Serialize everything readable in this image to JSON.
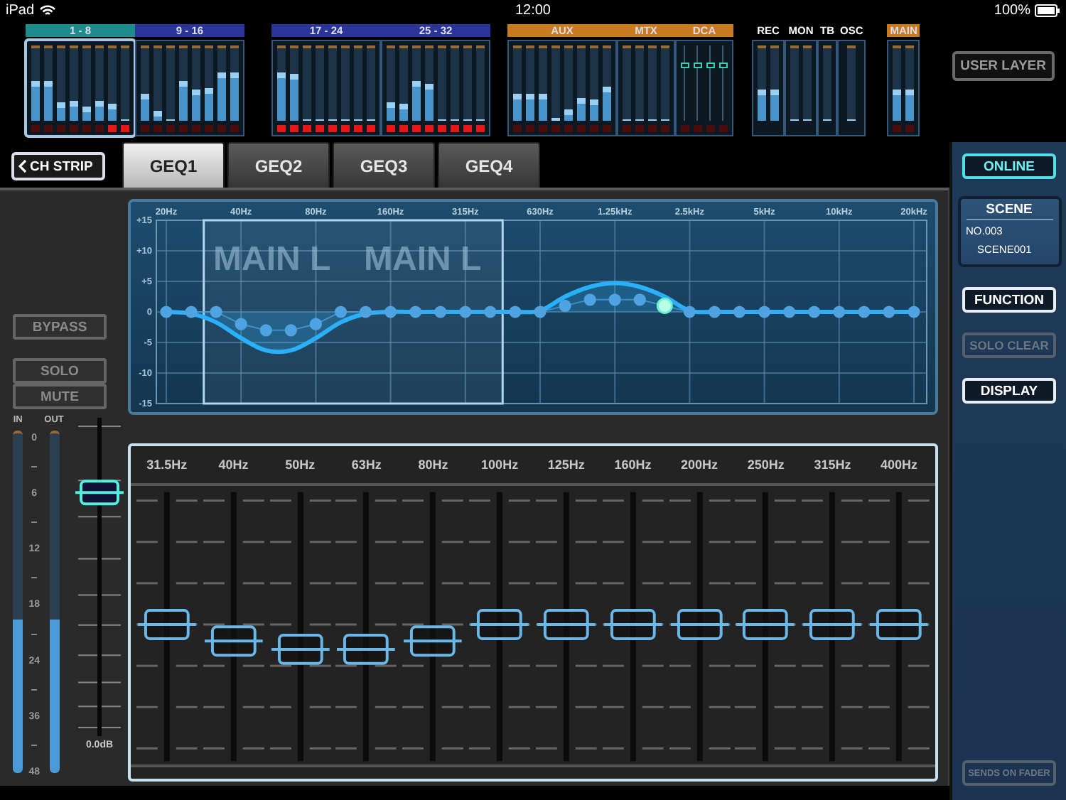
{
  "status_bar": {
    "device": "iPad",
    "time": "12:00",
    "battery": "100%"
  },
  "meter_bridge": {
    "blocks": [
      {
        "banks": [
          {
            "label": "1 - 8",
            "color": "#1e8c8c",
            "selected": true,
            "kind": "meters",
            "meters": [
              {
                "level": 0.55,
                "clip": false
              },
              {
                "level": 0.55,
                "clip": false
              },
              {
                "level": 0.26,
                "clip": false
              },
              {
                "level": 0.27,
                "clip": false
              },
              {
                "level": 0.2,
                "clip": false
              },
              {
                "level": 0.27,
                "clip": false
              },
              {
                "level": 0.24,
                "clip": true
              },
              {
                "level": 0,
                "clip": true
              }
            ]
          },
          {
            "label": "9 - 16",
            "color": "#2b3499",
            "selected": false,
            "kind": "meters",
            "meters": [
              {
                "level": 0.37,
                "clip": false
              },
              {
                "level": 0.14,
                "clip": false
              },
              {
                "level": 0.02,
                "clip": false
              },
              {
                "level": 0.55,
                "clip": false
              },
              {
                "level": 0.43,
                "clip": false
              },
              {
                "level": 0.45,
                "clip": false
              },
              {
                "level": 0.67,
                "clip": false
              },
              {
                "level": 0.67,
                "clip": false
              }
            ]
          }
        ]
      },
      {
        "banks": [
          {
            "label": "17 - 24",
            "color": "#2b3499",
            "selected": false,
            "kind": "meters",
            "meters": [
              {
                "level": 0.67,
                "clip": true
              },
              {
                "level": 0.64,
                "clip": true
              },
              {
                "level": 0,
                "clip": true
              },
              {
                "level": 0,
                "clip": true
              },
              {
                "level": 0,
                "clip": true
              },
              {
                "level": 0,
                "clip": true
              },
              {
                "level": 0,
                "clip": true
              },
              {
                "level": 0,
                "clip": true
              }
            ]
          },
          {
            "label": "25 - 32",
            "color": "#2b3499",
            "selected": false,
            "kind": "meters",
            "meters": [
              {
                "level": 0.26,
                "clip": true
              },
              {
                "level": 0.23,
                "clip": true
              },
              {
                "level": 0.55,
                "clip": true
              },
              {
                "level": 0.51,
                "clip": true
              },
              {
                "level": 0,
                "clip": true
              },
              {
                "level": 0,
                "clip": true
              },
              {
                "level": 0,
                "clip": true
              },
              {
                "level": 0,
                "clip": true
              }
            ]
          }
        ]
      },
      {
        "banks": [
          {
            "label": "AUX",
            "color": "#c97a1e",
            "selected": false,
            "kind": "meters",
            "meters": [
              {
                "level": 0.37,
                "clip": false
              },
              {
                "level": 0.37,
                "clip": false
              },
              {
                "level": 0.37,
                "clip": false
              },
              {
                "level": 0.04,
                "clip": false
              },
              {
                "level": 0.17,
                "clip": false
              },
              {
                "level": 0.31,
                "clip": false
              },
              {
                "level": 0.3,
                "clip": false
              },
              {
                "level": 0.48,
                "clip": false
              }
            ]
          },
          {
            "label": "MTX",
            "color": "#c97a1e",
            "selected": false,
            "kind": "meters",
            "meters": [
              {
                "level": 0,
                "clip": false
              },
              {
                "level": 0,
                "clip": false
              },
              {
                "level": 0,
                "clip": false
              },
              {
                "level": 0,
                "clip": false
              }
            ]
          },
          {
            "label": "DCA",
            "color": "#c97a1e",
            "selected": false,
            "kind": "faders",
            "meters": [
              {
                "level": 0.75,
                "clip": false
              },
              {
                "level": 0.75,
                "clip": false
              },
              {
                "level": 0.75,
                "clip": false
              },
              {
                "level": 0.75,
                "clip": false
              }
            ]
          }
        ]
      },
      {
        "banks": [
          {
            "label": "REC",
            "selected": false,
            "kind": "meters",
            "meters": [
              {
                "level": 0.43
              },
              {
                "level": 0.43
              }
            ]
          },
          {
            "label": "MON",
            "selected": false,
            "kind": "meters",
            "meters": [
              {
                "level": 0
              },
              {
                "level": 0
              }
            ]
          },
          {
            "label": "TB",
            "selected": false,
            "kind": "meters",
            "meters": [
              {
                "level": 0
              }
            ]
          },
          {
            "label": "OSC",
            "selected": false,
            "kind": "meters",
            "meters": [
              {
                "level": 0
              }
            ]
          }
        ]
      },
      {
        "banks": [
          {
            "label": "MAIN",
            "color": "#c97a1e",
            "selected": false,
            "kind": "meters",
            "meters": [
              {
                "level": 0.43,
                "clip": false
              },
              {
                "level": 0.43,
                "clip": false
              }
            ]
          }
        ]
      }
    ],
    "user_layer_button": "USER LAYER"
  },
  "toolbar": {
    "back_button": "CH STRIP",
    "tabs": [
      {
        "label": "GEQ1",
        "selected": true
      },
      {
        "label": "GEQ2",
        "selected": false
      },
      {
        "label": "GEQ3",
        "selected": false
      },
      {
        "label": "GEQ4",
        "selected": false
      }
    ]
  },
  "left_controls": {
    "buttons": [
      {
        "label": "BYPASS",
        "on": false
      },
      {
        "label": "SOLO",
        "on": false
      },
      {
        "label": "MUTE",
        "on": false
      }
    ],
    "meters": [
      {
        "label": "IN",
        "level": 0.45
      },
      {
        "label": "OUT",
        "level": 0.45
      }
    ],
    "scale": [
      "0",
      "6",
      "12",
      "18",
      "24",
      "36",
      "48"
    ],
    "master_fader": {
      "level": 0.78,
      "reading": "0.0dB"
    }
  },
  "geq_graph": {
    "channel_labels": [
      "MAIN L",
      "MAIN L"
    ],
    "chart_data": {
      "type": "line",
      "categories": [
        "20Hz",
        null,
        null,
        "40Hz",
        null,
        null,
        "80Hz",
        null,
        null,
        "160Hz",
        null,
        null,
        "315Hz",
        null,
        null,
        "630Hz",
        null,
        null,
        "1.25kHz",
        null,
        null,
        "2.5kHz",
        null,
        null,
        "5kHz",
        null,
        null,
        "10kHz",
        null,
        null,
        "20kHz"
      ],
      "series": [
        {
          "color": "#2ab0f8",
          "values": [
            0,
            -0.3,
            -1.7,
            -4.3,
            -6.3,
            -6.3,
            -4.3,
            -1.7,
            -0.3,
            0,
            0,
            0,
            0,
            0,
            0,
            0.2,
            2.5,
            4.1,
            4.7,
            4.1,
            2.5,
            0.2,
            0,
            0,
            0,
            0,
            0,
            0,
            0,
            0,
            0
          ]
        },
        {
          "color": "#4fa3e0",
          "marker": "circle",
          "values": [
            0,
            0,
            0,
            -2,
            -3,
            -3,
            -2,
            0,
            0,
            0,
            0,
            0,
            0,
            0,
            0,
            0,
            1,
            2,
            2,
            2,
            1,
            0,
            0,
            0,
            0,
            0,
            0,
            0,
            0,
            0,
            0
          ]
        },
        {
          "color": "#b8ffe8",
          "marker": "circle",
          "values": [
            null,
            null,
            null,
            null,
            null,
            null,
            null,
            null,
            null,
            null,
            null,
            null,
            null,
            null,
            null,
            null,
            null,
            null,
            null,
            null,
            1,
            null,
            null,
            null,
            null,
            null,
            null,
            null,
            null,
            null,
            null
          ]
        }
      ],
      "ylim": [
        -15,
        15
      ],
      "grid": true,
      "yticks": [
        {
          "value": 15,
          "label": "+15"
        },
        {
          "value": 10,
          "label": "+10"
        },
        {
          "value": 5,
          "label": "+5"
        },
        0,
        -5,
        -10,
        -15
      ]
    }
  },
  "faders": {
    "items": [
      {
        "label": "31.5Hz",
        "level": 0.5
      },
      {
        "label": "40Hz",
        "level": 0.4333
      },
      {
        "label": "50Hz",
        "level": 0.4
      },
      {
        "label": "63Hz",
        "level": 0.4
      },
      {
        "label": "80Hz",
        "level": 0.4333
      },
      {
        "label": "100Hz",
        "level": 0.5
      },
      {
        "label": "125Hz",
        "level": 0.5
      },
      {
        "label": "160Hz",
        "level": 0.5
      },
      {
        "label": "200Hz",
        "level": 0.5
      },
      {
        "label": "250Hz",
        "level": 0.5
      },
      {
        "label": "315Hz",
        "level": 0.5
      },
      {
        "label": "400Hz",
        "level": 0.5
      }
    ]
  },
  "side_panel": {
    "online_button": {
      "label": "ONLINE",
      "on": true
    },
    "scene": {
      "title": "SCENE",
      "number": "NO.003",
      "name": "SCENE001"
    },
    "buttons": [
      {
        "label": "FUNCTION",
        "disabled": false
      },
      {
        "label": "SOLO CLEAR",
        "disabled": true
      },
      {
        "label": "DISPLAY",
        "disabled": false
      }
    ],
    "bottom_button": {
      "label": "SENDS ON FADER",
      "disabled": true
    }
  }
}
